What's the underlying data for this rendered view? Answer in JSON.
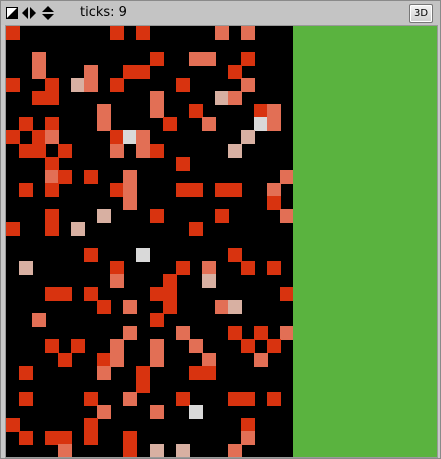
{
  "toolbar": {
    "ticks_label": "ticks: 9",
    "view_3d_label": "3D",
    "icons": [
      "edit-shape-icon",
      "left-right-arrows-icon",
      "up-down-arrows-icon"
    ]
  },
  "colors": {
    "background": "#000000",
    "field_green": "#5ab33f",
    "cell_red": "#d8330f",
    "cell_mid": "#e26f55",
    "cell_light": "#d8b0a2",
    "cell_white": "#d9d9d9"
  },
  "grid": {
    "columns": 22,
    "rows": 33,
    "cells": [
      [
        0,
        0,
        "r"
      ],
      [
        8,
        0,
        "r"
      ],
      [
        10,
        0,
        "r"
      ],
      [
        16,
        0,
        "m"
      ],
      [
        18,
        0,
        "m"
      ],
      [
        2,
        2,
        "m"
      ],
      [
        11,
        2,
        "r"
      ],
      [
        14,
        2,
        "m"
      ],
      [
        15,
        2,
        "m"
      ],
      [
        18,
        2,
        "r"
      ],
      [
        2,
        3,
        "m"
      ],
      [
        6,
        3,
        "m"
      ],
      [
        9,
        3,
        "r"
      ],
      [
        10,
        3,
        "r"
      ],
      [
        17,
        3,
        "r"
      ],
      [
        0,
        4,
        "r"
      ],
      [
        3,
        4,
        "r"
      ],
      [
        5,
        4,
        "l"
      ],
      [
        6,
        4,
        "m"
      ],
      [
        8,
        4,
        "r"
      ],
      [
        13,
        4,
        "r"
      ],
      [
        18,
        4,
        "m"
      ],
      [
        2,
        5,
        "r"
      ],
      [
        3,
        5,
        "r"
      ],
      [
        11,
        5,
        "m"
      ],
      [
        16,
        5,
        "l"
      ],
      [
        17,
        5,
        "m"
      ],
      [
        7,
        6,
        "m"
      ],
      [
        11,
        6,
        "m"
      ],
      [
        14,
        6,
        "r"
      ],
      [
        19,
        6,
        "r"
      ],
      [
        20,
        6,
        "m"
      ],
      [
        1,
        7,
        "r"
      ],
      [
        3,
        7,
        "r"
      ],
      [
        7,
        7,
        "m"
      ],
      [
        12,
        7,
        "r"
      ],
      [
        15,
        7,
        "m"
      ],
      [
        19,
        7,
        "w"
      ],
      [
        20,
        7,
        "m"
      ],
      [
        0,
        8,
        "r"
      ],
      [
        2,
        8,
        "r"
      ],
      [
        3,
        8,
        "m"
      ],
      [
        8,
        8,
        "r"
      ],
      [
        9,
        8,
        "w"
      ],
      [
        10,
        8,
        "m"
      ],
      [
        18,
        8,
        "l"
      ],
      [
        1,
        9,
        "r"
      ],
      [
        2,
        9,
        "r"
      ],
      [
        4,
        9,
        "r"
      ],
      [
        8,
        9,
        "m"
      ],
      [
        10,
        9,
        "m"
      ],
      [
        11,
        9,
        "r"
      ],
      [
        17,
        9,
        "l"
      ],
      [
        3,
        10,
        "r"
      ],
      [
        13,
        10,
        "r"
      ],
      [
        3,
        11,
        "m"
      ],
      [
        4,
        11,
        "r"
      ],
      [
        6,
        11,
        "r"
      ],
      [
        9,
        11,
        "m"
      ],
      [
        21,
        11,
        "m"
      ],
      [
        1,
        12,
        "r"
      ],
      [
        3,
        12,
        "r"
      ],
      [
        8,
        12,
        "r"
      ],
      [
        9,
        12,
        "m"
      ],
      [
        13,
        12,
        "r"
      ],
      [
        14,
        12,
        "r"
      ],
      [
        16,
        12,
        "r"
      ],
      [
        17,
        12,
        "r"
      ],
      [
        20,
        12,
        "m"
      ],
      [
        9,
        13,
        "m"
      ],
      [
        20,
        13,
        "r"
      ],
      [
        3,
        14,
        "r"
      ],
      [
        7,
        14,
        "l"
      ],
      [
        11,
        14,
        "r"
      ],
      [
        16,
        14,
        "r"
      ],
      [
        21,
        14,
        "m"
      ],
      [
        0,
        15,
        "r"
      ],
      [
        3,
        15,
        "r"
      ],
      [
        5,
        15,
        "l"
      ],
      [
        14,
        15,
        "r"
      ],
      [
        6,
        17,
        "r"
      ],
      [
        10,
        17,
        "w"
      ],
      [
        17,
        17,
        "r"
      ],
      [
        1,
        18,
        "l"
      ],
      [
        8,
        18,
        "r"
      ],
      [
        13,
        18,
        "r"
      ],
      [
        15,
        18,
        "m"
      ],
      [
        18,
        18,
        "r"
      ],
      [
        20,
        18,
        "r"
      ],
      [
        8,
        19,
        "m"
      ],
      [
        12,
        19,
        "r"
      ],
      [
        15,
        19,
        "l"
      ],
      [
        3,
        20,
        "r"
      ],
      [
        4,
        20,
        "r"
      ],
      [
        6,
        20,
        "r"
      ],
      [
        11,
        20,
        "r"
      ],
      [
        12,
        20,
        "r"
      ],
      [
        21,
        20,
        "r"
      ],
      [
        7,
        21,
        "r"
      ],
      [
        9,
        21,
        "m"
      ],
      [
        12,
        21,
        "r"
      ],
      [
        16,
        21,
        "m"
      ],
      [
        17,
        21,
        "l"
      ],
      [
        2,
        22,
        "m"
      ],
      [
        11,
        22,
        "r"
      ],
      [
        9,
        23,
        "m"
      ],
      [
        13,
        23,
        "m"
      ],
      [
        17,
        23,
        "r"
      ],
      [
        19,
        23,
        "r"
      ],
      [
        21,
        23,
        "m"
      ],
      [
        3,
        24,
        "r"
      ],
      [
        5,
        24,
        "r"
      ],
      [
        8,
        24,
        "m"
      ],
      [
        11,
        24,
        "m"
      ],
      [
        14,
        24,
        "m"
      ],
      [
        18,
        24,
        "r"
      ],
      [
        20,
        24,
        "r"
      ],
      [
        4,
        25,
        "r"
      ],
      [
        7,
        25,
        "r"
      ],
      [
        8,
        25,
        "m"
      ],
      [
        11,
        25,
        "m"
      ],
      [
        15,
        25,
        "m"
      ],
      [
        19,
        25,
        "m"
      ],
      [
        1,
        26,
        "r"
      ],
      [
        7,
        26,
        "m"
      ],
      [
        10,
        26,
        "r"
      ],
      [
        14,
        26,
        "r"
      ],
      [
        15,
        26,
        "r"
      ],
      [
        10,
        27,
        "r"
      ],
      [
        1,
        28,
        "r"
      ],
      [
        6,
        28,
        "r"
      ],
      [
        9,
        28,
        "m"
      ],
      [
        13,
        28,
        "r"
      ],
      [
        17,
        28,
        "r"
      ],
      [
        18,
        28,
        "r"
      ],
      [
        20,
        28,
        "r"
      ],
      [
        7,
        29,
        "m"
      ],
      [
        11,
        29,
        "m"
      ],
      [
        14,
        29,
        "w"
      ],
      [
        0,
        30,
        "r"
      ],
      [
        6,
        30,
        "r"
      ],
      [
        18,
        30,
        "r"
      ],
      [
        1,
        31,
        "r"
      ],
      [
        3,
        31,
        "r"
      ],
      [
        4,
        31,
        "r"
      ],
      [
        6,
        31,
        "r"
      ],
      [
        9,
        31,
        "r"
      ],
      [
        18,
        31,
        "m"
      ],
      [
        4,
        32,
        "m"
      ],
      [
        9,
        32,
        "r"
      ],
      [
        11,
        32,
        "l"
      ],
      [
        13,
        32,
        "l"
      ],
      [
        17,
        32,
        "m"
      ]
    ]
  }
}
